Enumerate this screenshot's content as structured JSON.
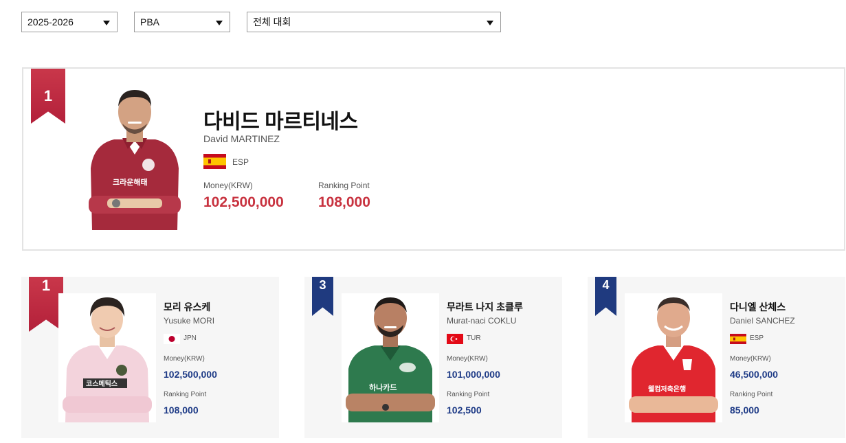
{
  "filters": {
    "season": "2025-2026",
    "league": "PBA",
    "event": "전체 대회"
  },
  "featured": {
    "rank": "1",
    "name_ko": "다비드 마르티네스",
    "name_en": "David MARTINEZ",
    "nationality": "ESP",
    "money_label": "Money(KRW)",
    "money": "102,500,000",
    "points_label": "Ranking Point",
    "points": "108,000",
    "jersey_text": "크라운해태"
  },
  "cards": [
    {
      "rank": "1",
      "name_ko": "모리 유스케",
      "name_en": "Yusuke MORI",
      "nationality": "JPN",
      "money_label": "Money(KRW)",
      "money": "102,500,000",
      "points_label": "Ranking Point",
      "points": "108,000",
      "jersey_text": "코스메틱스"
    },
    {
      "rank": "3",
      "name_ko": "무라트 나지 초클루",
      "name_en": "Murat-naci COKLU",
      "nationality": "TUR",
      "money_label": "Money(KRW)",
      "money": "101,000,000",
      "points_label": "Ranking Point",
      "points": "102,500",
      "jersey_text": "하나카드"
    },
    {
      "rank": "4",
      "name_ko": "다니엘 산체스",
      "name_en": "Daniel SANCHEZ",
      "nationality": "ESP",
      "money_label": "Money(KRW)",
      "money": "46,500,000",
      "points_label": "Ranking Point",
      "points": "85,000",
      "jersey_text": "웰컴저축은행"
    }
  ],
  "colors": {
    "accent_red": "#c8323f",
    "accent_blue": "#1d3a86",
    "ribbon_blue": "#1f3a7f",
    "card_bg": "#f6f6f6"
  },
  "icons": {
    "dropdown": "triangle-down",
    "flag_esp": "spain-flag",
    "flag_jpn": "japan-flag",
    "flag_tur": "turkey-flag"
  }
}
